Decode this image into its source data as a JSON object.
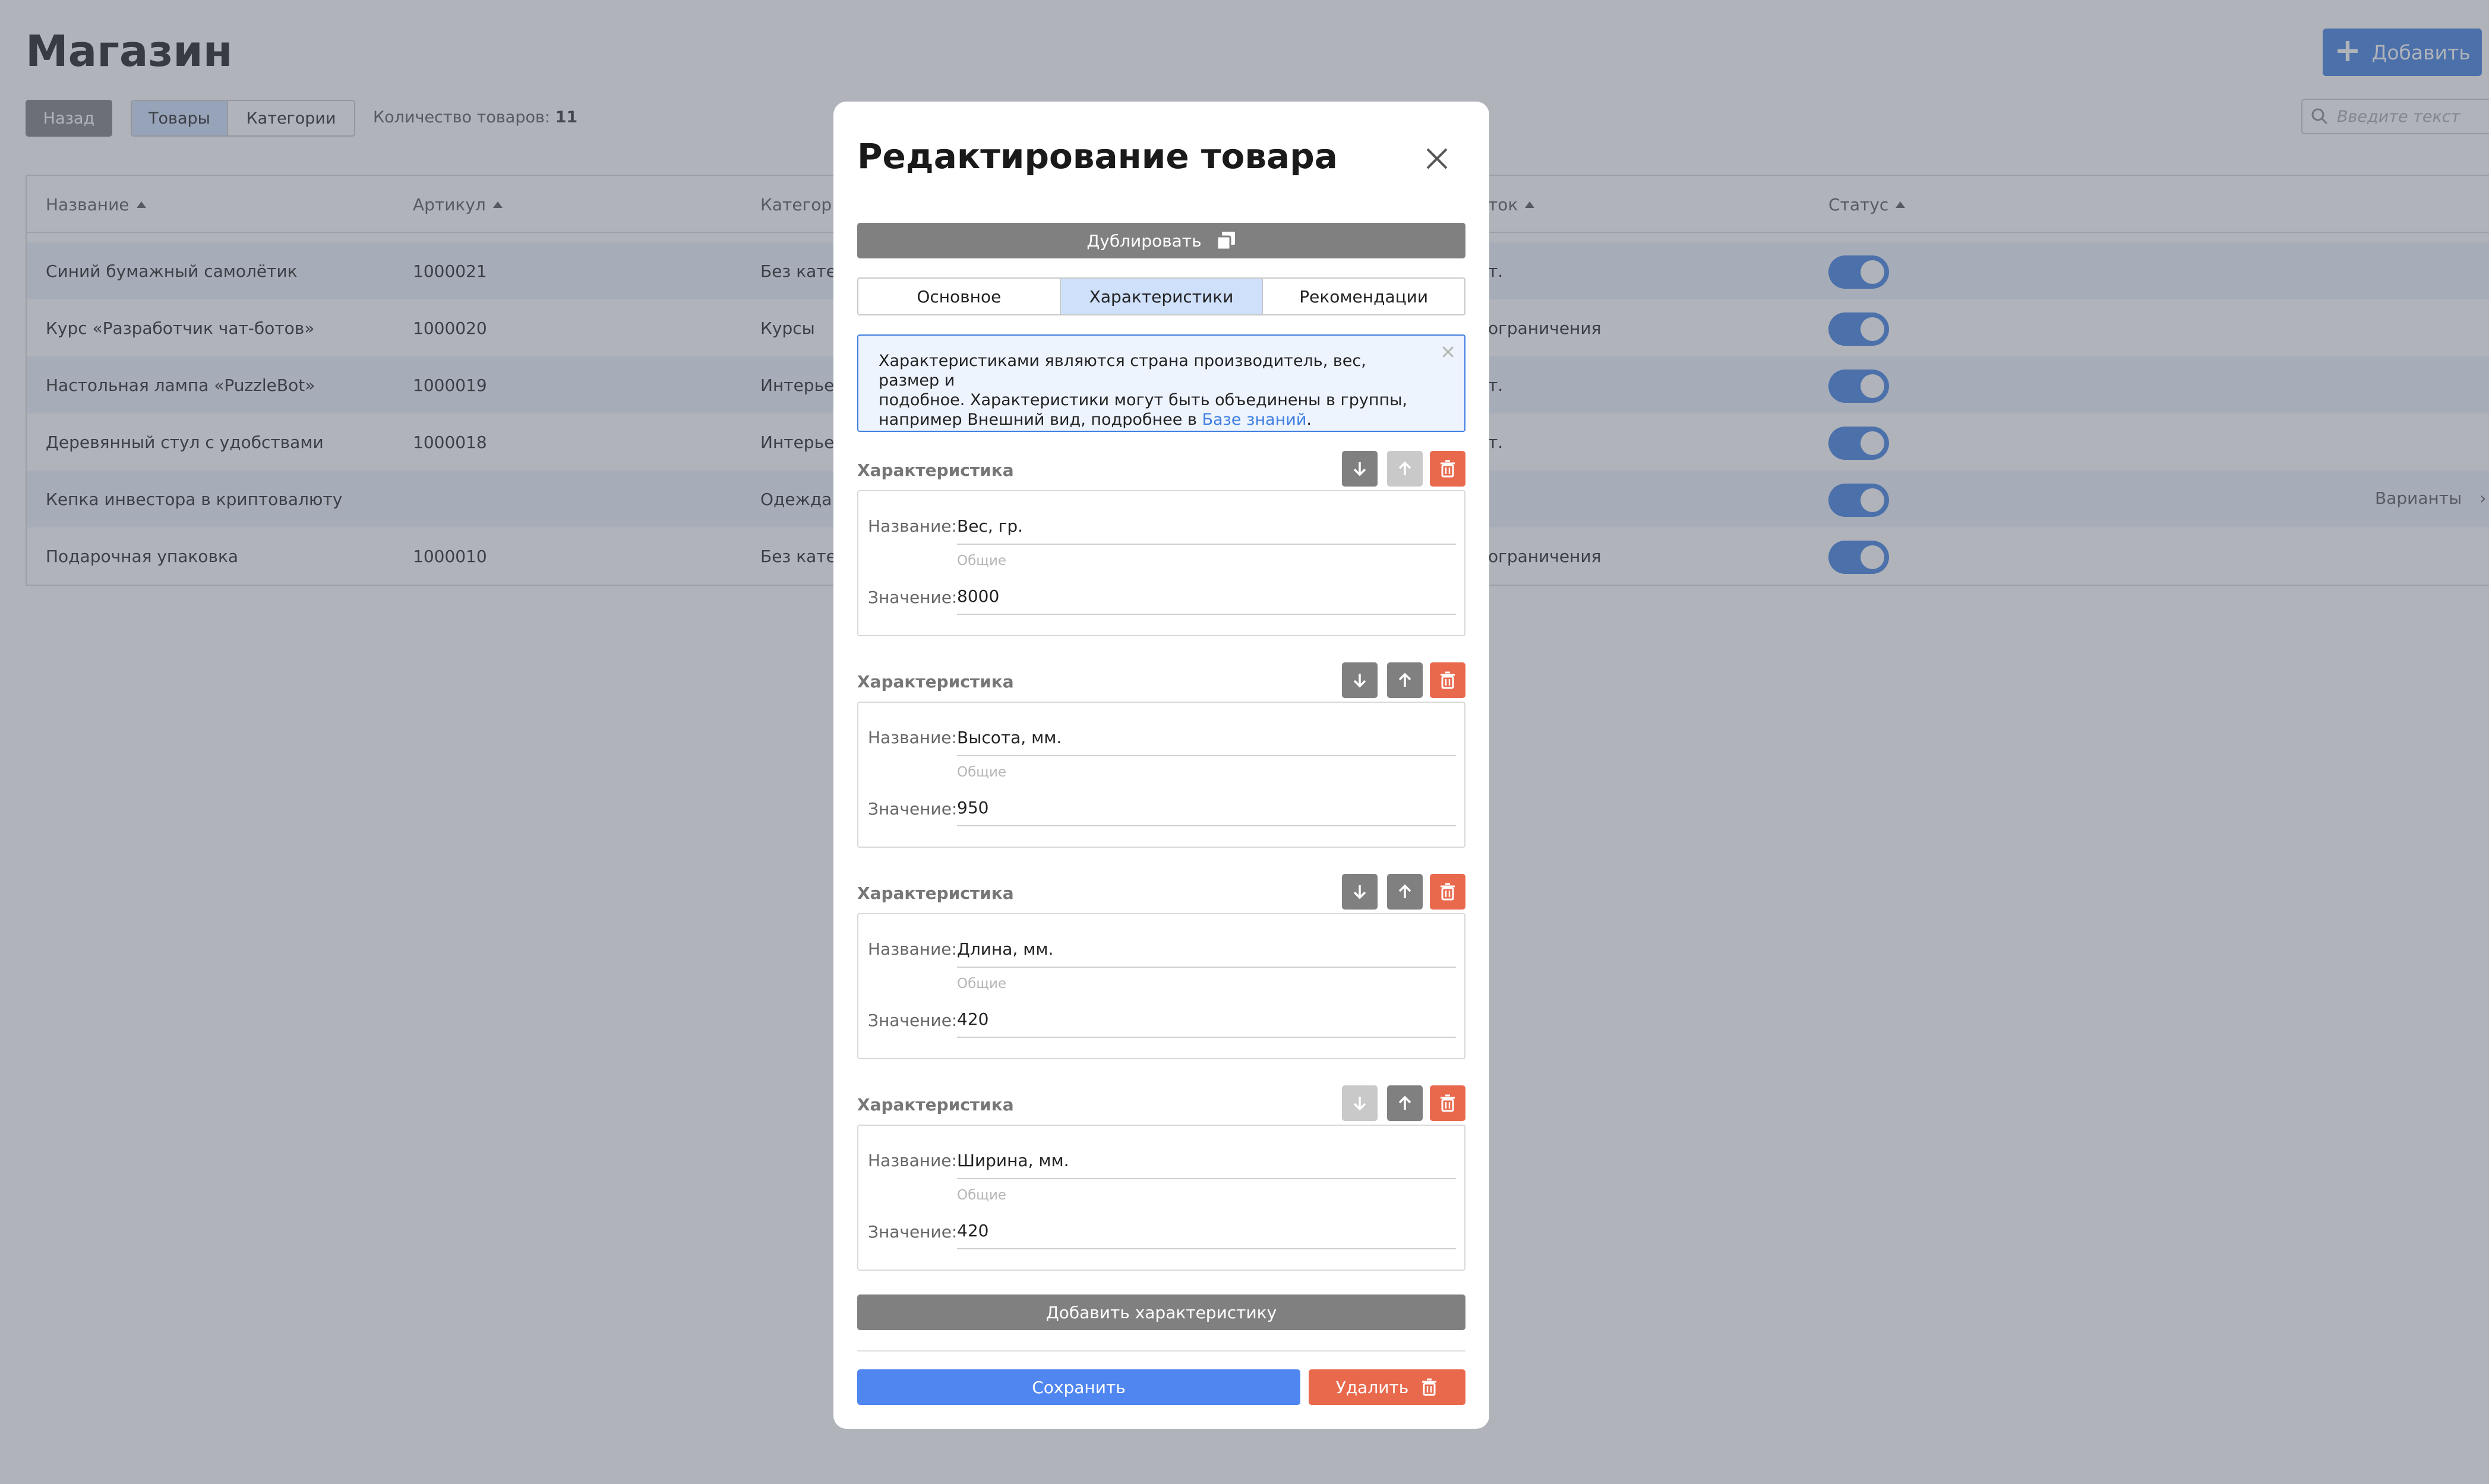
{
  "page": {
    "title": "Магазин",
    "add_label": "Добавить",
    "back_label": "Назад",
    "tabs": [
      "Товары",
      "Категории"
    ],
    "count_label": "Количество товаров:",
    "count_value": "11",
    "search_placeholder": "Введите текст",
    "columns": [
      "Название",
      "Артикул",
      "Категор",
      "ток",
      "Статус"
    ],
    "rows": [
      {
        "name": "Синий бумажный самолётик",
        "sku": "1000021",
        "category": "Без катег",
        "stock": "т."
      },
      {
        "name": "Курс «Разработчик чат-ботов»",
        "sku": "1000020",
        "category": "Курсы",
        "stock": "ограничения"
      },
      {
        "name": "Настольная лампа «PuzzleBot»",
        "sku": "1000019",
        "category": "Интерьер",
        "stock": "т."
      },
      {
        "name": "Деревянный стул с удобствами",
        "sku": "1000018",
        "category": "Интерьер",
        "stock": "т."
      },
      {
        "name": "Кепка инвестора в криптовалюту",
        "sku": "",
        "category": "Одежда",
        "stock": "",
        "variants": "Варианты"
      },
      {
        "name": "Подарочная упаковка",
        "sku": "1000010",
        "category": "Без катег",
        "stock": "ограничения"
      }
    ]
  },
  "modal": {
    "title": "Редактирование товара",
    "duplicate_label": "Дублировать",
    "tabs": [
      "Основное",
      "Характеристики",
      "Рекомендации"
    ],
    "info": {
      "line1": "Характеристиками являются страна производитель, вес, размер и",
      "line2": "подобное. Характеристики могут быть объединены в группы,",
      "line3_prefix": "например Внешний вид, подробнее в ",
      "link": "Базе знаний",
      "line3_suffix": "."
    },
    "char_label": "Характеристика",
    "name_label": "Название:",
    "value_label": "Значение:",
    "characteristics": [
      {
        "name": "Вес, гр.",
        "group": "Общие",
        "value": "8000"
      },
      {
        "name": "Высота, мм.",
        "group": "Общие",
        "value": "950"
      },
      {
        "name": "Длина, мм.",
        "group": "Общие",
        "value": "420"
      },
      {
        "name": "Ширина, мм.",
        "group": "Общие",
        "value": "420"
      }
    ],
    "add_char_label": "Добавить характеристику",
    "save_label": "Сохранить",
    "delete_label": "Удалить"
  }
}
